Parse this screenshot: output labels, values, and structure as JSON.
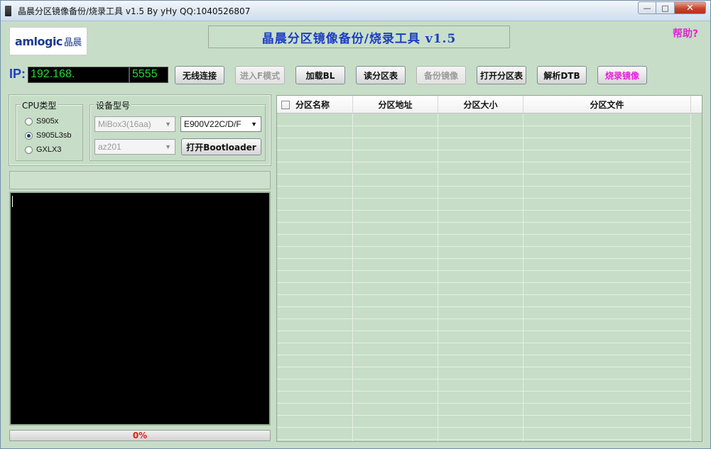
{
  "window": {
    "title": "晶晨分区镜像备份/烧录工具 v1.5 By yHy QQ:1040526807",
    "controls": {
      "minimize": "—",
      "maximize": "□",
      "close": "✕"
    }
  },
  "header": {
    "logo_text": "amlogic",
    "logo_cn": "晶晨",
    "app_title": "晶晨分区镜像备份/烧录工具   v1.5",
    "help_label": "帮助?"
  },
  "connection": {
    "ip_label": "IP:",
    "ip_value": "192.168.",
    "port_value": "5555"
  },
  "toolbar": {
    "buttons": [
      {
        "label": "无线连接",
        "enabled": true
      },
      {
        "label": "进入F模式",
        "enabled": false
      },
      {
        "label": "加载BL",
        "enabled": true
      },
      {
        "label": "读分区表",
        "enabled": true
      },
      {
        "label": "备份镜像",
        "enabled": false
      },
      {
        "label": "打开分区表",
        "enabled": true
      },
      {
        "label": "解析DTB",
        "enabled": true
      },
      {
        "label": "烧录镜像",
        "enabled": true,
        "color": "#e224d8"
      }
    ]
  },
  "cpu_group": {
    "label": "CPU类型",
    "options": [
      {
        "label": "S905x",
        "selected": false
      },
      {
        "label": "S905L3sb",
        "selected": true
      },
      {
        "label": "GXLX3",
        "selected": false
      }
    ]
  },
  "device_group": {
    "label": "设备型号",
    "model_select": "MiBox3(16aa)",
    "variant_select": "E900V22C/D/F",
    "board_select": "az201",
    "bootloader_button": "打开Bootloader"
  },
  "progress": {
    "value_percent": 0,
    "label": "0%"
  },
  "partition_table": {
    "columns": [
      "分区名称",
      "分区地址",
      "分区大小",
      "分区文件"
    ],
    "rows": []
  },
  "colors": {
    "window_bg": "#c7ddc7",
    "accent_blue": "#1d3fc4",
    "ip_text": "#27d83a",
    "magenta": "#e224d8",
    "progress_text": "#e0201a"
  }
}
